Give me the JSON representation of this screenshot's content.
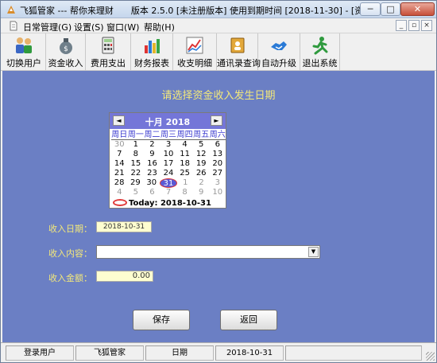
{
  "window": {
    "title": "飞狐管家 --- 帮你来理财　　版本 2.5.0 [未注册版本]  使用到期时间 [2018-11-30] - [资金收入录入]",
    "min_glyph": "─",
    "max_glyph": "□",
    "close_glyph": "✕"
  },
  "menu": {
    "items": [
      "日常管理(G)",
      "设置(S)",
      "窗口(W)",
      "帮助(H)"
    ],
    "mdi": [
      "_",
      "▫",
      "×"
    ]
  },
  "toolbar": {
    "items": [
      {
        "label": "切换用户",
        "icon": "users-icon"
      },
      {
        "label": "资金收入",
        "icon": "money-bag-icon"
      },
      {
        "label": "费用支出",
        "icon": "calculator-icon"
      },
      {
        "label": "财务报表",
        "icon": "bar-chart-icon"
      },
      {
        "label": "收支明细",
        "icon": "line-chart-icon"
      },
      {
        "label": "通讯录查询",
        "icon": "address-book-icon"
      },
      {
        "label": "自动升级",
        "icon": "handshake-icon"
      },
      {
        "label": "退出系统",
        "icon": "running-man-icon"
      }
    ]
  },
  "form": {
    "prompt": "请选择资金收入发生日期",
    "date_label": "收入日期：",
    "date_value": "2018-10-31",
    "content_label": "收入内容：",
    "content_value": "",
    "amount_label": "收入金额：",
    "amount_value": "0.00",
    "save_label": "保存",
    "return_label": "返回"
  },
  "calendar": {
    "prev": "◄",
    "next": "►",
    "title": "十月 2018",
    "weekdays": [
      "周日",
      "周一",
      "周二",
      "周三",
      "周四",
      "周五",
      "周六"
    ],
    "weeks": [
      [
        "30",
        "1",
        "2",
        "3",
        "4",
        "5",
        "6"
      ],
      [
        "7",
        "8",
        "9",
        "10",
        "11",
        "12",
        "13"
      ],
      [
        "14",
        "15",
        "16",
        "17",
        "18",
        "19",
        "20"
      ],
      [
        "21",
        "22",
        "23",
        "24",
        "25",
        "26",
        "27"
      ],
      [
        "28",
        "29",
        "30",
        "31",
        "1",
        "2",
        "3"
      ],
      [
        "4",
        "5",
        "6",
        "7",
        "8",
        "9",
        "10"
      ]
    ],
    "today_text": "Today: 2018-10-31",
    "accent": "#7476d8"
  },
  "statusbar": {
    "cells": [
      "登录用户",
      "飞狐管家",
      "日期",
      "2018-10-31"
    ]
  },
  "colors": {
    "client_bg": "#6b7fc4",
    "label_text": "#f3e87a"
  }
}
